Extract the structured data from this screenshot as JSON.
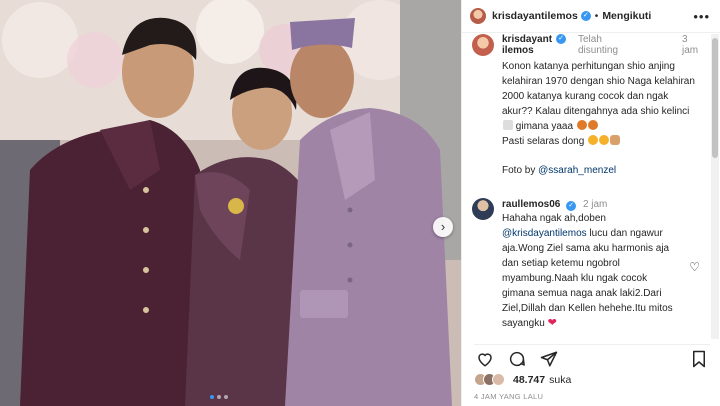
{
  "post": {
    "username": "krisdayantilemos",
    "follow_label": "Mengikuti",
    "more_label": "•••",
    "bullet": "•"
  },
  "caption": {
    "username": "krisdayantilemos",
    "edited_label": "Telah disunting",
    "time": "3 jam",
    "line1": "Konon katanya perhitungan shio anjing kelahiran 1970 dengan shio Naga kelahiran 2000 katanya kurang cocok dan ngak akur?? Kalau ditengahnya ada shio kelinci",
    "line1b": "gimana yaaa",
    "line2": "Pasti selaras dong",
    "photo_credit_prefix": "Foto by",
    "photo_credit_mention": "@ssarah_menzel"
  },
  "reply": {
    "username": "raullemos06",
    "time": "2 jam",
    "text_a": "Hahaha ngak ah,doben",
    "mention": "@krisdayantilemos",
    "text_b": "lucu dan ngawur aja.Wong Ziel sama aku harmonis aja dan setiap ketemu ngobrol myambung.Naah klu ngak cocok gimana semua naga anak laki2.Dari Ziel,Dillah dan Kellen hehehe.Itu mitos sayangku"
  },
  "stats": {
    "likes_count": "48.747",
    "likes_label": "suka",
    "time_ago": "4 JAM YANG LALU"
  },
  "icons": {
    "verified": "verified-badge-icon",
    "like": "heart-outline-icon",
    "comment": "comment-bubble-icon",
    "share": "paper-plane-icon",
    "save": "bookmark-icon",
    "next": "chevron-right-icon"
  },
  "colors": {
    "verified_blue": "#3897f0",
    "mention_blue": "#00376b",
    "muted_gray": "#8e8e8e"
  }
}
